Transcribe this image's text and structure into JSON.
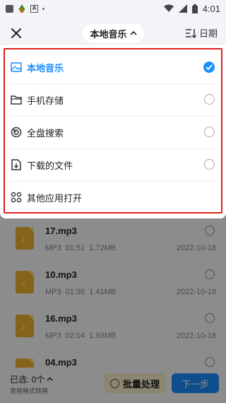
{
  "status_bar": {
    "time": "4:01",
    "app_letter": "A"
  },
  "header": {
    "title": "本地音乐",
    "sort_label": "日期"
  },
  "menu": {
    "items": [
      {
        "label": "本地音乐",
        "icon": "image-folder-icon",
        "selected": true
      },
      {
        "label": "手机存储",
        "icon": "folder-icon",
        "selected": false
      },
      {
        "label": "全盘搜索",
        "icon": "radar-search-icon",
        "selected": false
      },
      {
        "label": "下载的文件",
        "icon": "download-file-icon",
        "selected": false
      },
      {
        "label": "其他应用打开",
        "icon": "apps-grid-icon",
        "selected": false
      }
    ]
  },
  "files": [
    {
      "name": "17.mp3",
      "format": "MP3",
      "duration": "01:51",
      "size": "1.72MB",
      "date": "2022-10-18"
    },
    {
      "name": "10.mp3",
      "format": "MP3",
      "duration": "01:30",
      "size": "1.41MB",
      "date": "2022-10-18"
    },
    {
      "name": "16.mp3",
      "format": "MP3",
      "duration": "02:04",
      "size": "1.93MB",
      "date": "2022-10-18"
    },
    {
      "name": "04.mp3",
      "format": "",
      "duration": "",
      "size": "",
      "date": ""
    }
  ],
  "bottom": {
    "selected_label": "已选: 0个",
    "sub_label": "音频格式转换",
    "batch_label": "批量处理",
    "next_label": "下一步"
  },
  "colors": {
    "accent": "#1a8fff",
    "highlight_frame": "#e02020",
    "file_icon": "#f3b52c"
  }
}
